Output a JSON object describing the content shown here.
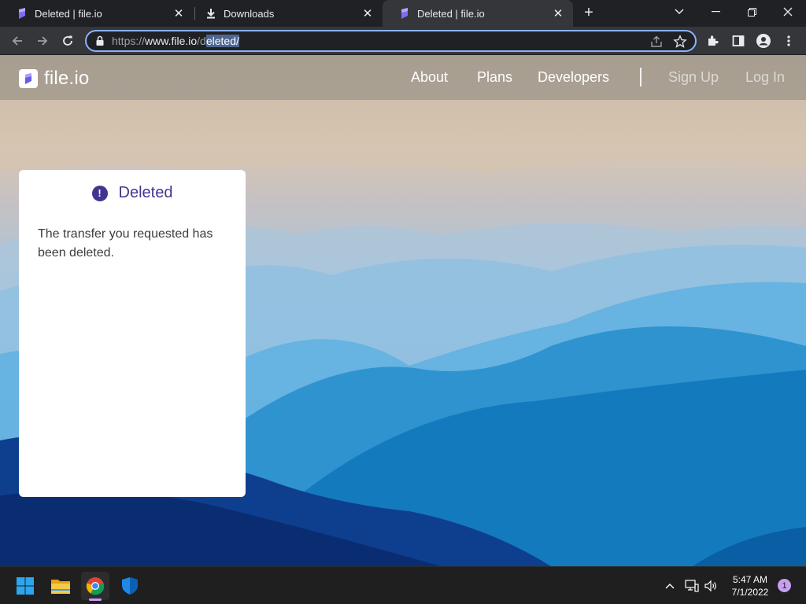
{
  "browser": {
    "tabs": [
      {
        "title": "Deleted | file.io",
        "icon": "fileio-favicon"
      },
      {
        "title": "Downloads",
        "icon": "download-icon"
      },
      {
        "title": "Deleted | file.io",
        "icon": "fileio-favicon"
      }
    ],
    "active_tab": 2,
    "url": {
      "scheme": "https://",
      "host": "www.file.io",
      "path_prefix": "/d",
      "path_selected": "eleted/"
    },
    "accent": "#8ab4f8"
  },
  "site": {
    "logo_text": "file.io",
    "nav": {
      "about": "About",
      "plans": "Plans",
      "developers": "Developers",
      "sign_up": "Sign Up",
      "log_in": "Log In"
    },
    "card": {
      "icon": "!",
      "title": "Deleted",
      "message": "The transfer you requested has been deleted."
    },
    "brand_color": "#41368f"
  },
  "taskbar": {
    "time": "5:47 AM",
    "date": "7/1/2022",
    "notifications": "1"
  }
}
